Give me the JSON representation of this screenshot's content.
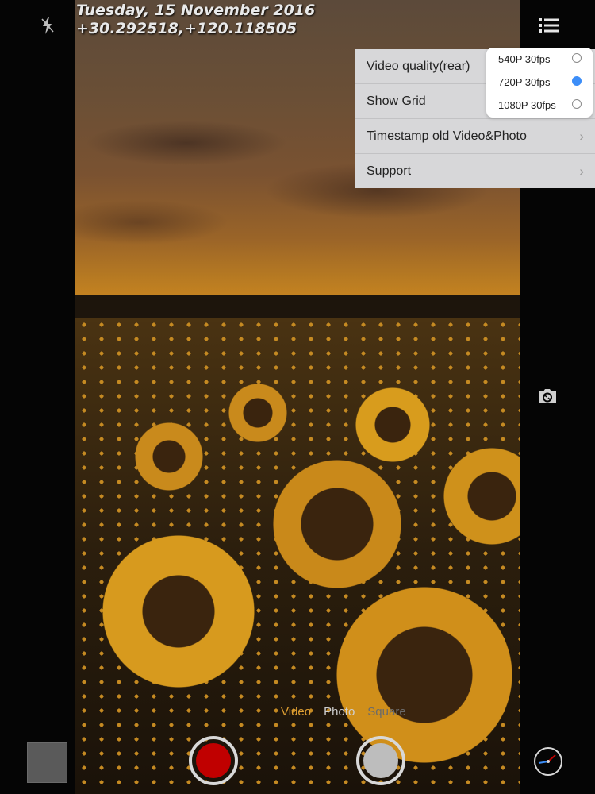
{
  "overlay": {
    "date": "Tuesday, 15 November 2016",
    "coordinates": "+30.292518,+120.118505"
  },
  "settings_menu": {
    "items": [
      {
        "label": "Video quality(rear)"
      },
      {
        "label": "Show Grid"
      },
      {
        "label": "Timestamp old Video&Photo"
      },
      {
        "label": "Support"
      }
    ]
  },
  "quality_popover": {
    "options": [
      {
        "label": "540P 30fps",
        "selected": false
      },
      {
        "label": "720P 30fps",
        "selected": true
      },
      {
        "label": "1080P 30fps",
        "selected": false
      }
    ]
  },
  "modes": {
    "video": "Video",
    "photo": "Photo",
    "square": "Square"
  },
  "icons": {
    "flash": "flash-off-icon",
    "menu": "list-menu-icon",
    "switch_camera": "switch-camera-icon",
    "gauge": "gauge-icon"
  },
  "colors": {
    "active_mode": "#e0a033",
    "record": "#c00000",
    "radio_selected": "#3d8ef8"
  }
}
